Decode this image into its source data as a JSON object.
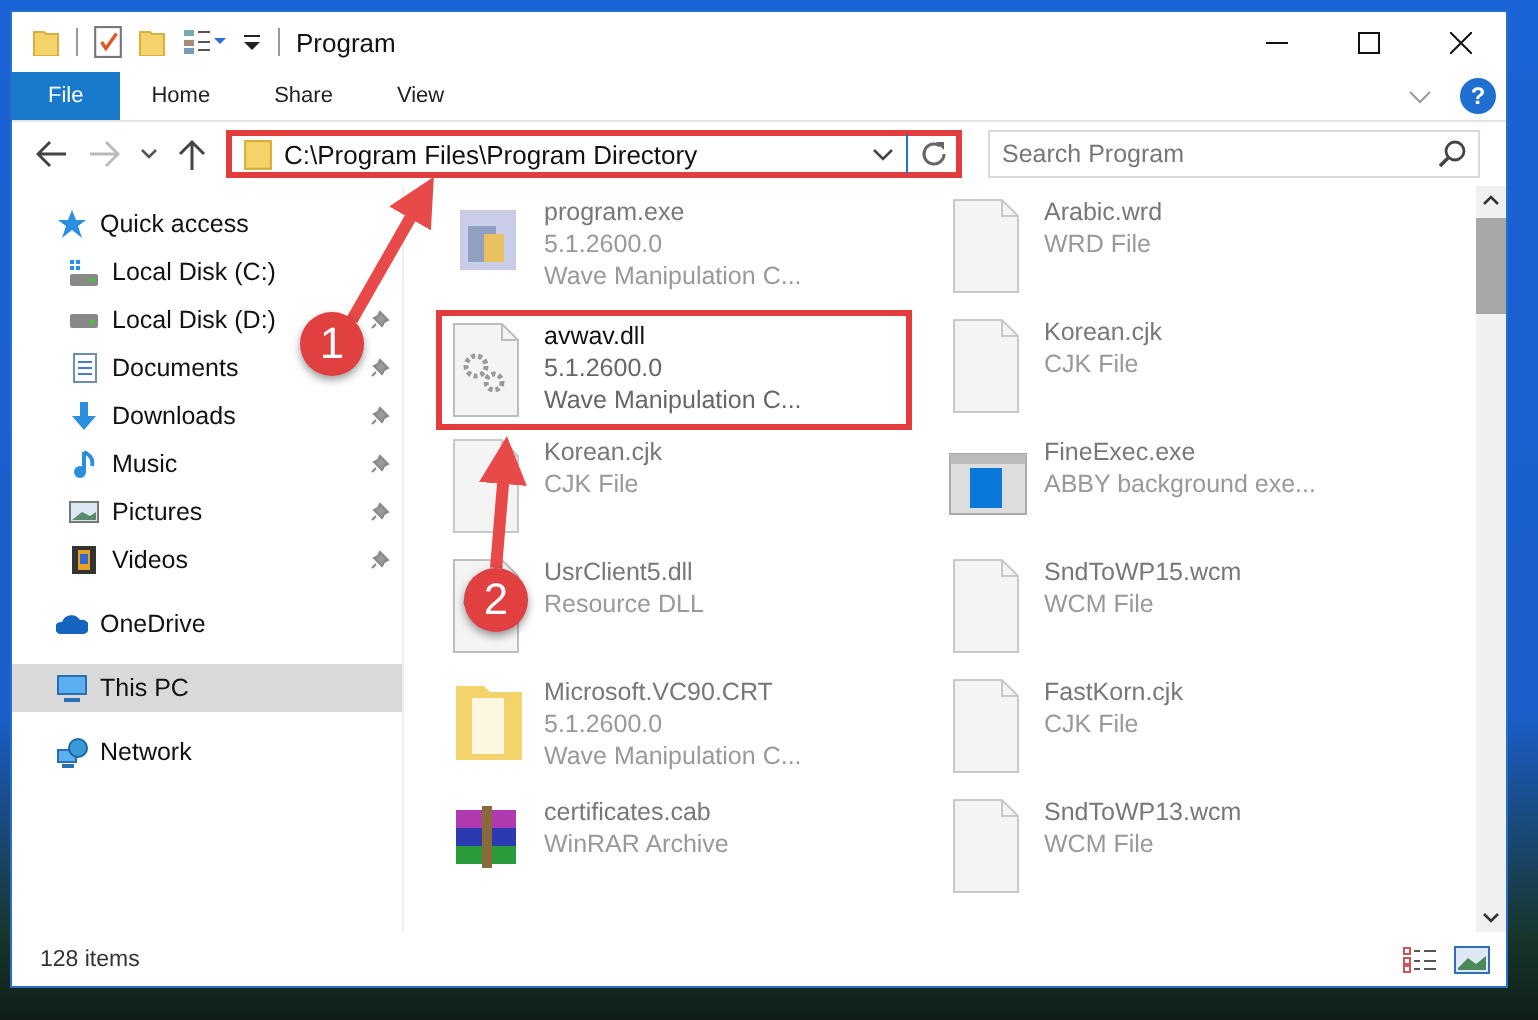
{
  "window": {
    "title": "Program"
  },
  "ribbon": {
    "tabs": [
      {
        "label": "File",
        "selected": true
      },
      {
        "label": "Home",
        "selected": false
      },
      {
        "label": "Share",
        "selected": false
      },
      {
        "label": "View",
        "selected": false
      }
    ],
    "help": "?"
  },
  "address_bar": {
    "path": "C:\\Program Files\\Program Directory",
    "highlighted": true
  },
  "search": {
    "placeholder": "Search Program"
  },
  "sidebar": {
    "items": [
      {
        "label": "Quick access",
        "kind": "star",
        "pinned": false,
        "selected": false,
        "children": [
          {
            "label": "Local Disk (C:)",
            "kind": "drive-c",
            "pinned": false,
            "selected": false
          },
          {
            "label": "Local Disk (D:)",
            "kind": "drive",
            "pinned": true,
            "selected": false
          },
          {
            "label": "Documents",
            "kind": "documents",
            "pinned": true,
            "selected": false
          },
          {
            "label": "Downloads",
            "kind": "downloads",
            "pinned": true,
            "selected": false
          },
          {
            "label": "Music",
            "kind": "music",
            "pinned": true,
            "selected": false
          },
          {
            "label": "Pictures",
            "kind": "pictures",
            "pinned": true,
            "selected": false
          },
          {
            "label": "Videos",
            "kind": "videos",
            "pinned": true,
            "selected": false
          }
        ]
      },
      {
        "label": "OneDrive",
        "kind": "cloud",
        "pinned": false,
        "selected": false
      },
      {
        "label": "This PC",
        "kind": "pc",
        "pinned": false,
        "selected": true
      },
      {
        "label": "Network",
        "kind": "network",
        "pinned": false,
        "selected": false
      }
    ]
  },
  "files": [
    {
      "name": "program.exe",
      "details": [
        "5.1.2600.0",
        "Wave Manipulation C..."
      ],
      "kind": "app",
      "highlighted": false
    },
    {
      "name": "Arabic.wrd",
      "details": [
        "WRD File"
      ],
      "kind": "blank",
      "highlighted": false
    },
    {
      "name": "avwav.dll",
      "details": [
        "5.1.2600.0",
        "Wave Manipulation C..."
      ],
      "kind": "dll",
      "highlighted": true
    },
    {
      "name": "Korean.cjk",
      "details": [
        "CJK File"
      ],
      "kind": "blank",
      "highlighted": false
    },
    {
      "name": "Korean.cjk",
      "details": [
        "CJK File"
      ],
      "kind": "blank",
      "highlighted": false
    },
    {
      "name": "FineExec.exe",
      "details": [
        "ABBY background exe..."
      ],
      "kind": "window",
      "highlighted": false
    },
    {
      "name": "UsrClient5.dll",
      "details": [
        "Resource DLL"
      ],
      "kind": "dll",
      "highlighted": false
    },
    {
      "name": "SndToWP15.wcm",
      "details": [
        "WCM File"
      ],
      "kind": "blank",
      "highlighted": false
    },
    {
      "name": "Microsoft.VC90.CRT",
      "details": [
        "5.1.2600.0",
        "Wave Manipulation C..."
      ],
      "kind": "folder",
      "highlighted": false
    },
    {
      "name": "FastKorn.cjk",
      "details": [
        "CJK File"
      ],
      "kind": "blank",
      "highlighted": false
    },
    {
      "name": "certificates.cab",
      "details": [
        "WinRAR Archive"
      ],
      "kind": "archive",
      "highlighted": false
    },
    {
      "name": "SndToWP13.wcm",
      "details": [
        "WCM File"
      ],
      "kind": "blank",
      "highlighted": false
    }
  ],
  "status_bar": {
    "count": "128 items"
  },
  "annotations": [
    {
      "number": "1"
    },
    {
      "number": "2"
    }
  ]
}
